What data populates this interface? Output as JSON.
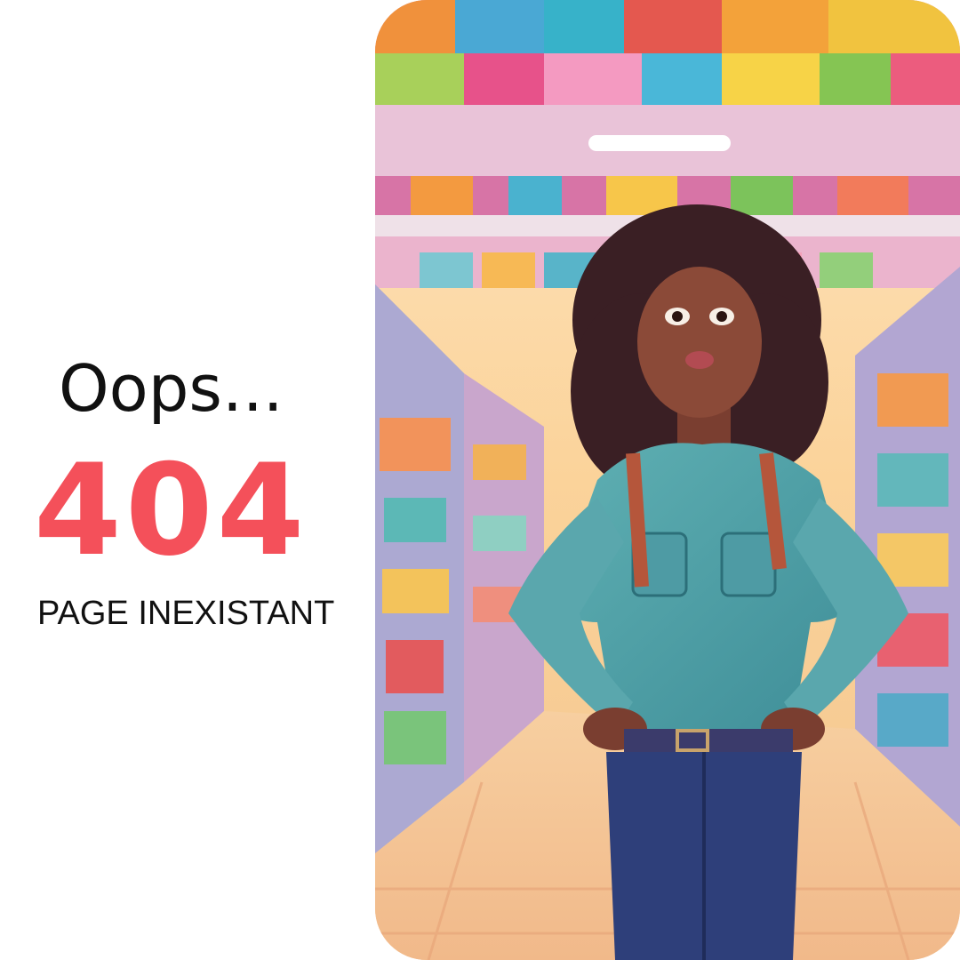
{
  "message": {
    "oops_text": "Oops...",
    "error_code": "404",
    "error_description": "PAGE INEXISTANT"
  },
  "colors": {
    "accent": "#F4505A",
    "text": "#111111",
    "background": "#FFFFFF"
  }
}
